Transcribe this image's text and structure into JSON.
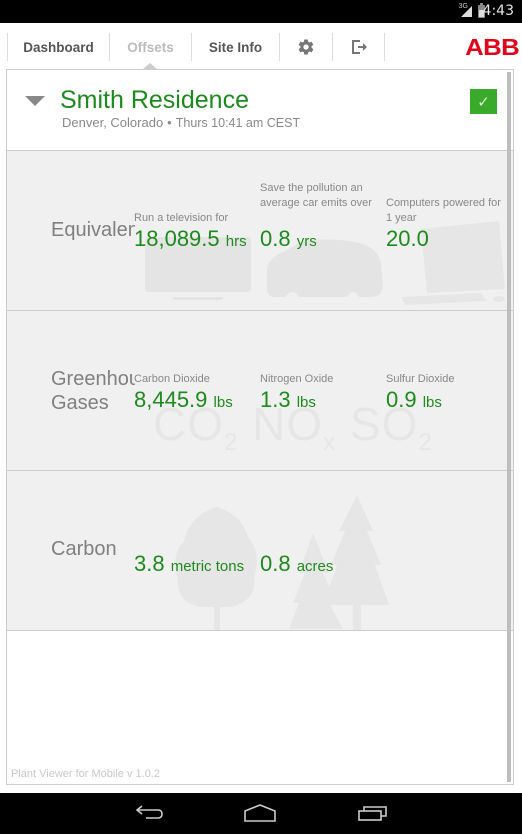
{
  "status_bar": {
    "network": "3G",
    "time": "4:43"
  },
  "nav": {
    "tabs": [
      {
        "label": "Dashboard",
        "active": false
      },
      {
        "label": "Offsets",
        "active": true
      },
      {
        "label": "Site Info",
        "active": false
      }
    ],
    "settings_icon": "gear-icon",
    "logout_icon": "logout-icon",
    "brand": "ABB"
  },
  "site": {
    "name": "Smith Residence",
    "location": "Denver, Colorado",
    "separator": "•",
    "local_time": "Thurs 10:41 am CEST",
    "status": "ok",
    "status_color": "#3aaa2a"
  },
  "sections": {
    "equivalents": {
      "label": "Equivalents",
      "metrics": [
        {
          "caption": "Run a television for",
          "value": "18,089.5",
          "unit": "hrs",
          "icon": "television-icon"
        },
        {
          "caption": "Save the pollution an average car emits over",
          "value": "0.8",
          "unit": "yrs",
          "icon": "car-icon"
        },
        {
          "caption": "Computers powered for 1 year",
          "value": "20.0",
          "unit": "",
          "icon": "computer-icon"
        }
      ]
    },
    "greenhouse": {
      "label": "Greenhouse\nGases",
      "metrics": [
        {
          "caption": "Carbon Dioxide",
          "value": "8,445.9",
          "unit": "lbs",
          "symbol": "CO",
          "sub": "2"
        },
        {
          "caption": "Nitrogen Oxide",
          "value": "1.3",
          "unit": "lbs",
          "symbol": "NO",
          "sub": "x"
        },
        {
          "caption": "Sulfur Dioxide",
          "value": "0.9",
          "unit": "lbs",
          "symbol": "SO",
          "sub": "2"
        }
      ]
    },
    "carbon": {
      "label": "Carbon",
      "metrics": [
        {
          "value": "3.8",
          "unit": "metric tons",
          "icon": "tree-icon"
        },
        {
          "value": "0.8",
          "unit": "acres",
          "icon": "forest-icon"
        }
      ]
    }
  },
  "footer": {
    "version": "Plant Viewer for Mobile v 1.0.2"
  },
  "colors": {
    "value_green": "#1d8a1d",
    "brand_red": "#e2061a"
  }
}
